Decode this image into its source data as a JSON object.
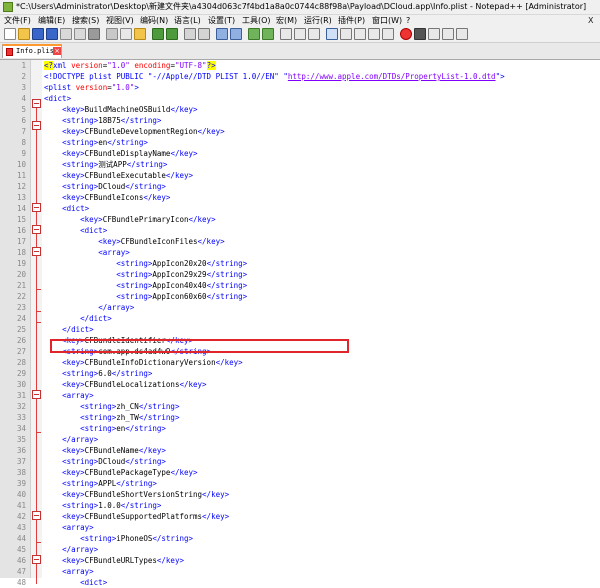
{
  "window": {
    "title": "*C:\\Users\\Administrator\\Desktop\\新建文件夹\\a4304d063c7f4bd1a8a0c0744c88f98a\\Payload\\DCloud.app\\Info.plist - Notepad++ [Administrator]"
  },
  "menu": {
    "items": [
      "文件(F)",
      "编辑(E)",
      "搜索(S)",
      "视图(V)",
      "编码(N)",
      "语言(L)",
      "设置(T)",
      "工具(O)",
      "宏(M)",
      "运行(R)",
      "插件(P)",
      "窗口(W)",
      "?"
    ],
    "close_label": "X"
  },
  "tab": {
    "label": "Info.plist",
    "close_symbol": "×"
  },
  "editor": {
    "lines": [
      [
        [
          "pi",
          "<?"
        ],
        [
          "tag",
          "xml "
        ],
        [
          "attr",
          "version"
        ],
        [
          "txt",
          "="
        ],
        [
          "val",
          "\"1.0\" "
        ],
        [
          "attr",
          "encoding"
        ],
        [
          "txt",
          "="
        ],
        [
          "val",
          "\"UTF-8\""
        ],
        [
          "pi",
          "?>"
        ]
      ],
      [
        [
          "tag",
          "<!DOCTYPE plist PUBLIC \"-//Apple//DTD PLIST 1.0//EN\" \""
        ],
        [
          "url",
          "http://www.apple.com/DTDs/PropertyList-1.0.dtd"
        ],
        [
          "tag",
          "\">"
        ]
      ],
      [
        [
          "tag",
          "<plist "
        ],
        [
          "attr",
          "version"
        ],
        [
          "txt",
          "="
        ],
        [
          "val",
          "\"1.0\""
        ],
        [
          "tag",
          ">"
        ]
      ],
      [
        [
          "tag",
          "<dict>"
        ]
      ],
      [
        [
          "txt",
          "    "
        ],
        [
          "tag",
          "<key>"
        ],
        [
          "txt",
          "BuildMachineOSBuild"
        ],
        [
          "tag",
          "</key>"
        ]
      ],
      [
        [
          "txt",
          "    "
        ],
        [
          "tag",
          "<string>"
        ],
        [
          "txt",
          "18B75"
        ],
        [
          "tag",
          "</string>"
        ]
      ],
      [
        [
          "txt",
          "    "
        ],
        [
          "tag",
          "<key>"
        ],
        [
          "txt",
          "CFBundleDevelopmentRegion"
        ],
        [
          "tag",
          "</key>"
        ]
      ],
      [
        [
          "txt",
          "    "
        ],
        [
          "tag",
          "<string>"
        ],
        [
          "txt",
          "en"
        ],
        [
          "tag",
          "</string>"
        ]
      ],
      [
        [
          "txt",
          "    "
        ],
        [
          "tag",
          "<key>"
        ],
        [
          "txt",
          "CFBundleDisplayName"
        ],
        [
          "tag",
          "</key>"
        ]
      ],
      [
        [
          "txt",
          "    "
        ],
        [
          "tag",
          "<string>"
        ],
        [
          "txt",
          "测试APP"
        ],
        [
          "tag",
          "</string>"
        ]
      ],
      [
        [
          "txt",
          "    "
        ],
        [
          "tag",
          "<key>"
        ],
        [
          "txt",
          "CFBundleExecutable"
        ],
        [
          "tag",
          "</key>"
        ]
      ],
      [
        [
          "txt",
          "    "
        ],
        [
          "tag",
          "<string>"
        ],
        [
          "txt",
          "DCloud"
        ],
        [
          "tag",
          "</string>"
        ]
      ],
      [
        [
          "txt",
          "    "
        ],
        [
          "tag",
          "<key>"
        ],
        [
          "txt",
          "CFBundleIcons"
        ],
        [
          "tag",
          "</key>"
        ]
      ],
      [
        [
          "txt",
          "    "
        ],
        [
          "tag",
          "<dict>"
        ]
      ],
      [
        [
          "txt",
          "        "
        ],
        [
          "tag",
          "<key>"
        ],
        [
          "txt",
          "CFBundlePrimaryIcon"
        ],
        [
          "tag",
          "</key>"
        ]
      ],
      [
        [
          "txt",
          "        "
        ],
        [
          "tag",
          "<dict>"
        ]
      ],
      [
        [
          "txt",
          "            "
        ],
        [
          "tag",
          "<key>"
        ],
        [
          "txt",
          "CFBundleIconFiles"
        ],
        [
          "tag",
          "</key>"
        ]
      ],
      [
        [
          "txt",
          "            "
        ],
        [
          "tag",
          "<array>"
        ]
      ],
      [
        [
          "txt",
          "                "
        ],
        [
          "tag",
          "<string>"
        ],
        [
          "txt",
          "AppIcon20x20"
        ],
        [
          "tag",
          "</string>"
        ]
      ],
      [
        [
          "txt",
          "                "
        ],
        [
          "tag",
          "<string>"
        ],
        [
          "txt",
          "AppIcon29x29"
        ],
        [
          "tag",
          "</string>"
        ]
      ],
      [
        [
          "txt",
          "                "
        ],
        [
          "tag",
          "<string>"
        ],
        [
          "txt",
          "AppIcon40x40"
        ],
        [
          "tag",
          "</string>"
        ]
      ],
      [
        [
          "txt",
          "                "
        ],
        [
          "tag",
          "<string>"
        ],
        [
          "txt",
          "AppIcon60x60"
        ],
        [
          "tag",
          "</string>"
        ]
      ],
      [
        [
          "txt",
          "            "
        ],
        [
          "tag",
          "</array>"
        ]
      ],
      [
        [
          "txt",
          "        "
        ],
        [
          "tag",
          "</dict>"
        ]
      ],
      [
        [
          "txt",
          "    "
        ],
        [
          "tag",
          "</dict>"
        ]
      ],
      [
        [
          "txt",
          "    "
        ],
        [
          "tag",
          "<key>"
        ],
        [
          "txt",
          "CFBundleIdentifier"
        ],
        [
          "tag",
          "</key>"
        ]
      ],
      [
        [
          "txt",
          "    "
        ],
        [
          "tag",
          "<string>"
        ],
        [
          "txt",
          "com.app.ds4ad4w9"
        ],
        [
          "tag",
          "</string>"
        ]
      ],
      [
        [
          "txt",
          "    "
        ],
        [
          "tag",
          "<key>"
        ],
        [
          "txt",
          "CFBundleInfoDictionaryVersion"
        ],
        [
          "tag",
          "</key>"
        ]
      ],
      [
        [
          "txt",
          "    "
        ],
        [
          "tag",
          "<string>"
        ],
        [
          "txt",
          "6.0"
        ],
        [
          "tag",
          "</string>"
        ]
      ],
      [
        [
          "txt",
          "    "
        ],
        [
          "tag",
          "<key>"
        ],
        [
          "txt",
          "CFBundleLocalizations"
        ],
        [
          "tag",
          "</key>"
        ]
      ],
      [
        [
          "txt",
          "    "
        ],
        [
          "tag",
          "<array>"
        ]
      ],
      [
        [
          "txt",
          "        "
        ],
        [
          "tag",
          "<string>"
        ],
        [
          "txt",
          "zh_CN"
        ],
        [
          "tag",
          "</string>"
        ]
      ],
      [
        [
          "txt",
          "        "
        ],
        [
          "tag",
          "<string>"
        ],
        [
          "txt",
          "zh_TW"
        ],
        [
          "tag",
          "</string>"
        ]
      ],
      [
        [
          "txt",
          "        "
        ],
        [
          "tag",
          "<string>"
        ],
        [
          "txt",
          "en"
        ],
        [
          "tag",
          "</string>"
        ]
      ],
      [
        [
          "txt",
          "    "
        ],
        [
          "tag",
          "</array>"
        ]
      ],
      [
        [
          "txt",
          "    "
        ],
        [
          "tag",
          "<key>"
        ],
        [
          "txt",
          "CFBundleName"
        ],
        [
          "tag",
          "</key>"
        ]
      ],
      [
        [
          "txt",
          "    "
        ],
        [
          "tag",
          "<string>"
        ],
        [
          "txt",
          "DCloud"
        ],
        [
          "tag",
          "</string>"
        ]
      ],
      [
        [
          "txt",
          "    "
        ],
        [
          "tag",
          "<key>"
        ],
        [
          "txt",
          "CFBundlePackageType"
        ],
        [
          "tag",
          "</key>"
        ]
      ],
      [
        [
          "txt",
          "    "
        ],
        [
          "tag",
          "<string>"
        ],
        [
          "txt",
          "APPL"
        ],
        [
          "tag",
          "</string>"
        ]
      ],
      [
        [
          "txt",
          "    "
        ],
        [
          "tag",
          "<key>"
        ],
        [
          "txt",
          "CFBundleShortVersionString"
        ],
        [
          "tag",
          "</key>"
        ]
      ],
      [
        [
          "txt",
          "    "
        ],
        [
          "tag",
          "<string>"
        ],
        [
          "txt",
          "1.0.0"
        ],
        [
          "tag",
          "</string>"
        ]
      ],
      [
        [
          "txt",
          "    "
        ],
        [
          "tag",
          "<key>"
        ],
        [
          "txt",
          "CFBundleSupportedPlatforms"
        ],
        [
          "tag",
          "</key>"
        ]
      ],
      [
        [
          "txt",
          "    "
        ],
        [
          "tag",
          "<array>"
        ]
      ],
      [
        [
          "txt",
          "        "
        ],
        [
          "tag",
          "<string>"
        ],
        [
          "txt",
          "iPhoneOS"
        ],
        [
          "tag",
          "</string>"
        ]
      ],
      [
        [
          "txt",
          "    "
        ],
        [
          "tag",
          "</array>"
        ]
      ],
      [
        [
          "txt",
          "    "
        ],
        [
          "tag",
          "<key>"
        ],
        [
          "txt",
          "CFBundleURLTypes"
        ],
        [
          "tag",
          "</key>"
        ]
      ],
      [
        [
          "txt",
          "    "
        ],
        [
          "tag",
          "<array>"
        ]
      ],
      [
        [
          "txt",
          "        "
        ],
        [
          "tag",
          "<dict>"
        ]
      ]
    ]
  }
}
